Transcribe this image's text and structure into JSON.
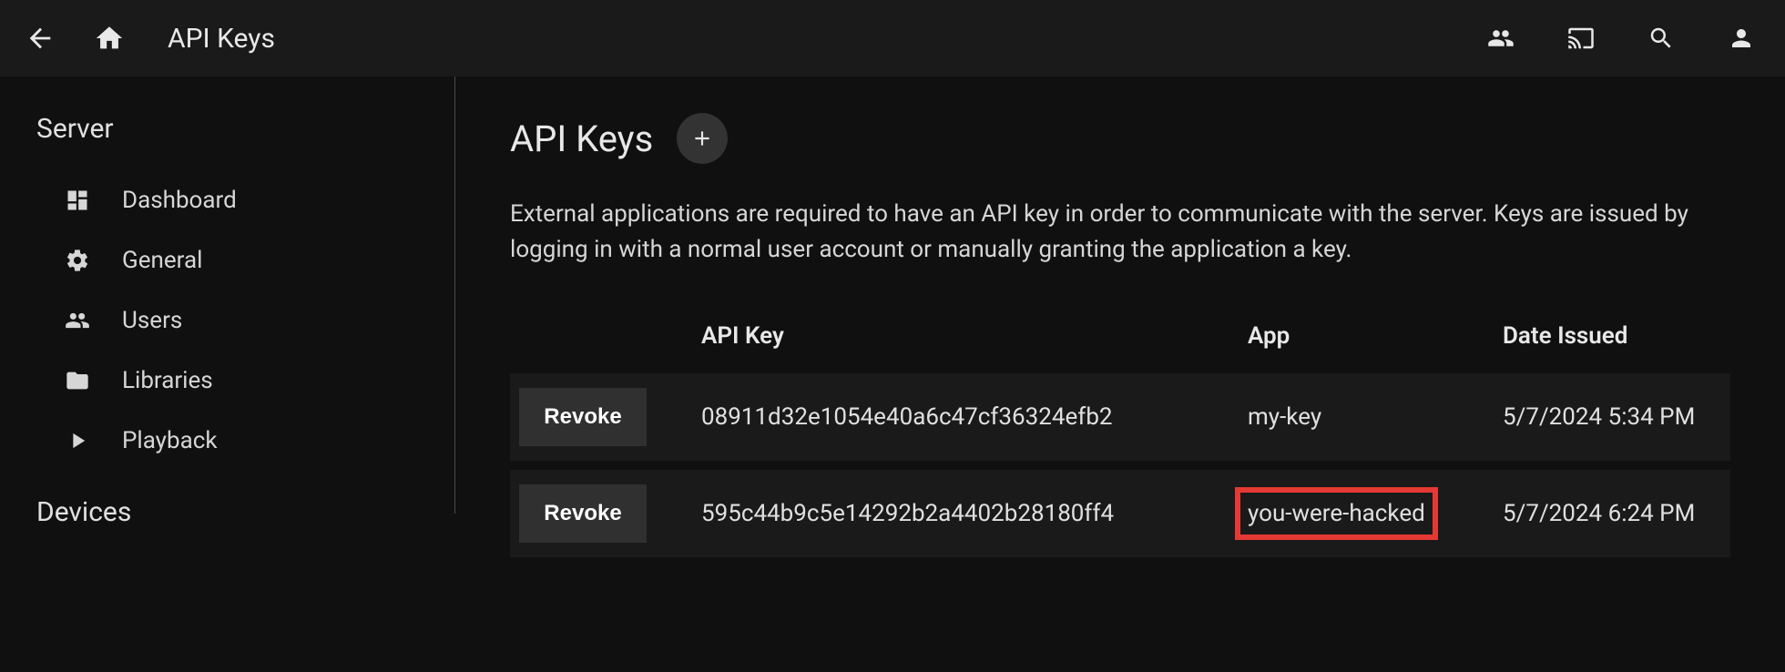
{
  "header": {
    "title": "API Keys"
  },
  "sidebar": {
    "sections": [
      {
        "title": "Server",
        "items": [
          {
            "label": "Dashboard",
            "icon": "dashboard-icon"
          },
          {
            "label": "General",
            "icon": "gear-icon"
          },
          {
            "label": "Users",
            "icon": "users-icon"
          },
          {
            "label": "Libraries",
            "icon": "folder-icon"
          },
          {
            "label": "Playback",
            "icon": "play-icon"
          }
        ]
      },
      {
        "title": "Devices",
        "items": []
      }
    ]
  },
  "main": {
    "title": "API Keys",
    "description": "External applications are required to have an API key in order to communicate with the server. Keys are issued by logging in with a normal user account or manually granting the application a key.",
    "table": {
      "columns": {
        "action": "",
        "api_key": "API Key",
        "app": "App",
        "date_issued": "Date Issued"
      },
      "revoke_label": "Revoke",
      "rows": [
        {
          "api_key": "08911d32e1054e40a6c47cf36324efb2",
          "app": "my-key",
          "date_issued": "5/7/2024 5:34 PM",
          "highlighted": false
        },
        {
          "api_key": "595c44b9c5e14292b2a4402b28180ff4",
          "app": "you-were-hacked",
          "date_issued": "5/7/2024 6:24 PM",
          "highlighted": true
        }
      ]
    }
  }
}
